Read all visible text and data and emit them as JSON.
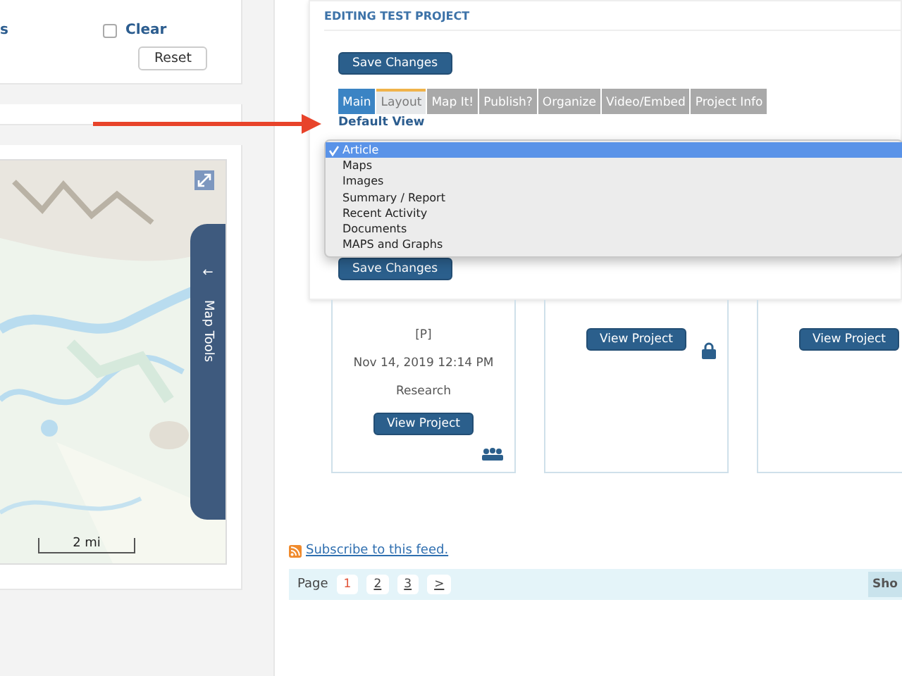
{
  "filters": {
    "link": "s",
    "clear": {
      "label": "Clear",
      "checked": false
    },
    "reset": "Reset"
  },
  "map": {
    "scale": "2 mi",
    "tools": "Map Tools",
    "tools_arrow": "←"
  },
  "editor": {
    "title": "EDITING TEST PROJECT",
    "save_top": "Save Changes",
    "save_bottom": "Save Changes",
    "tabs": [
      {
        "label": "Main",
        "selected": true,
        "hovered": false
      },
      {
        "label": "Layout",
        "selected": false,
        "hovered": true
      },
      {
        "label": "Map It!",
        "selected": false,
        "hovered": false
      },
      {
        "label": "Publish?",
        "selected": false,
        "hovered": false
      },
      {
        "label": "Organize",
        "selected": false,
        "hovered": false
      },
      {
        "label": "Video/Embed",
        "selected": false,
        "hovered": false
      },
      {
        "label": "Project Info",
        "selected": false,
        "hovered": false
      }
    ],
    "field_label": "Default View",
    "options": [
      {
        "label": "Article",
        "selected": true
      },
      {
        "label": "Maps",
        "selected": false
      },
      {
        "label": "Images",
        "selected": false
      },
      {
        "label": "Summary / Report",
        "selected": false
      },
      {
        "label": "Recent Activity",
        "selected": false
      },
      {
        "label": "Documents",
        "selected": false
      },
      {
        "label": "MAPS and Graphs",
        "selected": false
      }
    ]
  },
  "cards": [
    {
      "kind": "shared",
      "lines": [
        "[P]",
        "Nov 14, 2019 12:14 PM",
        "Research"
      ],
      "button": "View Project"
    },
    {
      "kind": "private",
      "button": "View Project"
    },
    {
      "kind": "plain",
      "button": "View Project"
    }
  ],
  "subscribe": "Subscribe to this feed.",
  "pager": {
    "label": "Page",
    "pages": [
      {
        "label": "1",
        "selected": true
      },
      {
        "label": "2",
        "selected": false
      },
      {
        "label": "3",
        "selected": false
      },
      {
        "label": ">",
        "selected": false
      }
    ],
    "show": "Sho"
  }
}
